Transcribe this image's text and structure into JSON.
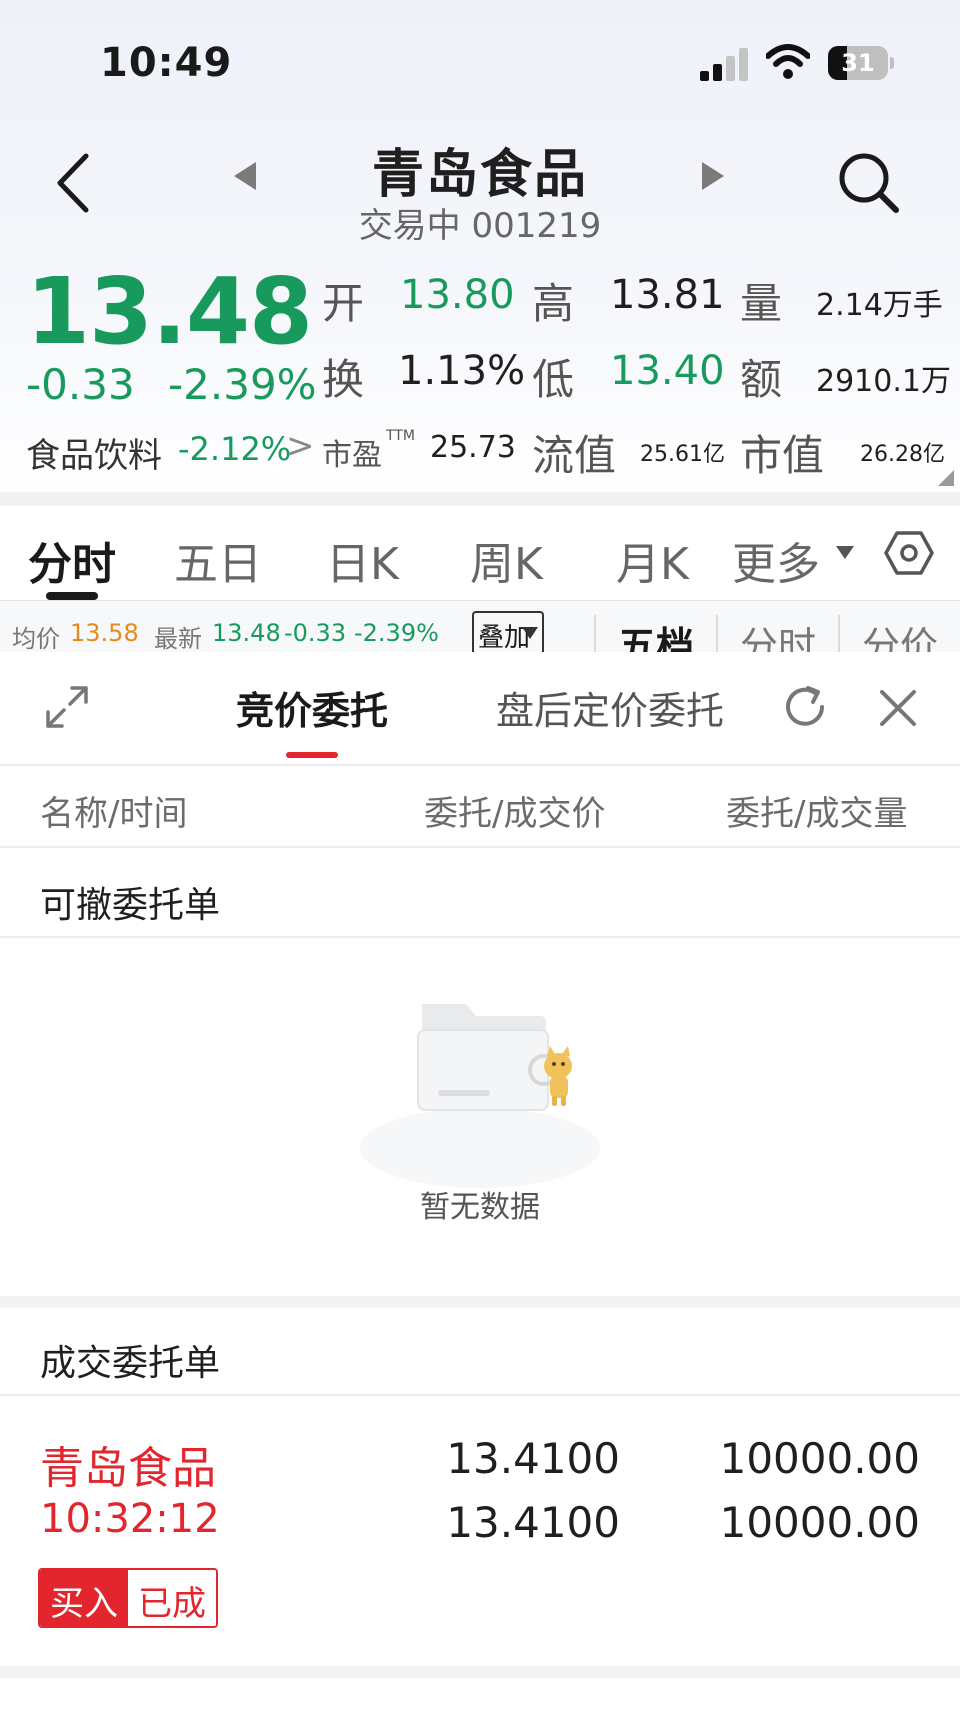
{
  "status_bar": {
    "time": "10:49",
    "battery": "31",
    "battery_level": 0.31
  },
  "nav": {
    "title": "青岛食品",
    "subtitle": "交易中 001219",
    "back_icon": "chevron-left-icon",
    "prev_icon": "triangle-left-icon",
    "next_icon": "triangle-right-icon",
    "search_icon": "search-icon"
  },
  "quote": {
    "price": "13.48",
    "change": "-0.33",
    "change_pct": "-2.39%",
    "open_label": "开",
    "open": "13.80",
    "high_label": "高",
    "high": "13.81",
    "volume_label": "量",
    "volume": "2.14万手",
    "turnover_label": "换",
    "turnover": "1.13%",
    "low_label": "低",
    "low": "13.40",
    "amount_label": "额",
    "amount": "2910.1万",
    "industry": "食品饮料",
    "industry_pct": "-2.12%",
    "industry_arrow": ">",
    "pe_label": "市盈",
    "pe_sup": "TTM",
    "pe": "25.73",
    "float_cap_label": "流值",
    "float_cap": "25.61亿",
    "market_cap_label": "市值",
    "market_cap": "26.28亿",
    "down_color": "#179a5c"
  },
  "chart_tabs": {
    "items": [
      "分时",
      "五日",
      "日K",
      "周K",
      "月K",
      "更多"
    ],
    "active": "分时",
    "settings_icon": "hexagon-settings-icon"
  },
  "info_strip": {
    "avg_label": "均价",
    "avg": "13.58",
    "latest_label": "最新",
    "latest": "13.48",
    "latest_chg": "-0.33",
    "latest_pct": "-2.39%",
    "overlay": "叠加",
    "side_tabs": [
      "五档",
      "分时",
      "分价"
    ]
  },
  "sheet": {
    "expand_icon": "expand-icon",
    "tabs": [
      "竞价委托",
      "盘后定价委托"
    ],
    "active_tab": "竞价委托",
    "refresh_icon": "refresh-icon",
    "close_icon": "close-icon",
    "columns": [
      "名称/时间",
      "委托/成交价",
      "委托/成交量"
    ],
    "cancelable_title": "可撤委托单",
    "empty_text": "暂无数据",
    "filled_title": "成交委托单",
    "orders": [
      {
        "name": "青岛食品",
        "time": "10:32:12",
        "order_price": "13.4100",
        "deal_price": "13.4100",
        "order_qty": "10000.00",
        "deal_qty": "10000.00",
        "side": "买入",
        "status": "已成"
      }
    ],
    "accent": "#e3262d"
  }
}
